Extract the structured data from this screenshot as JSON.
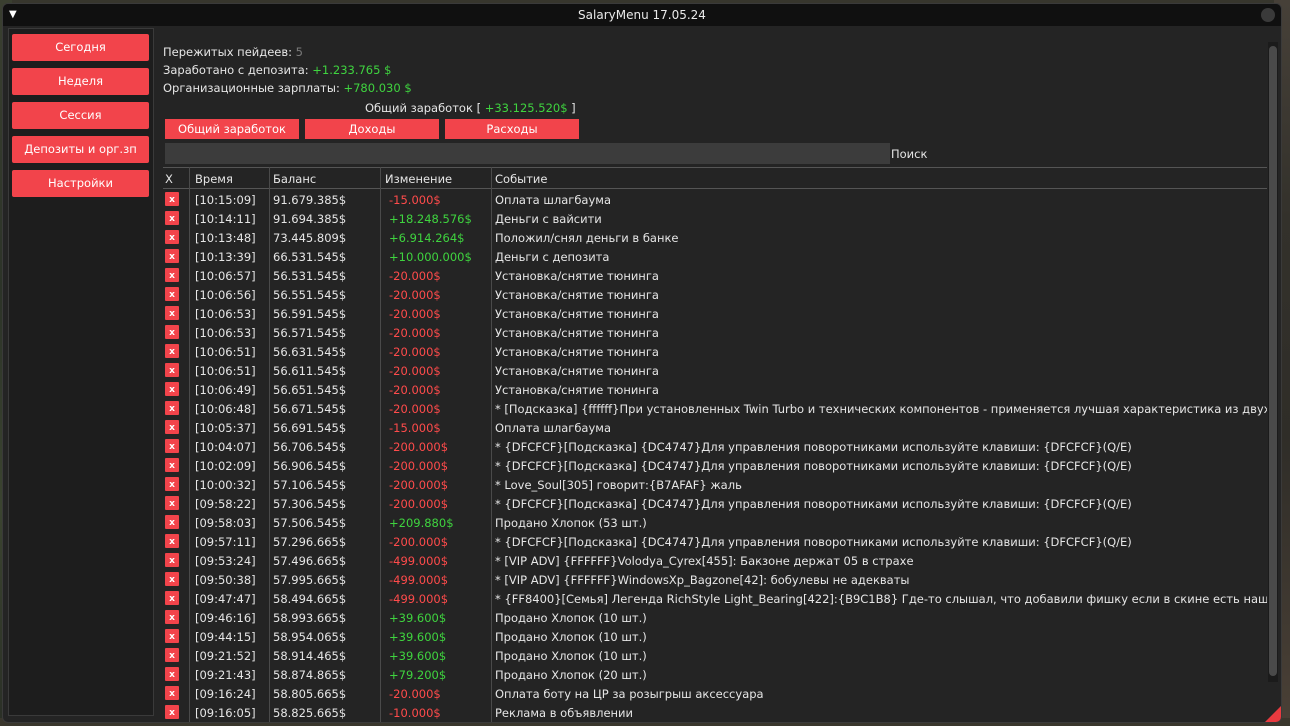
{
  "window": {
    "title": "SalaryMenu 17.05.24"
  },
  "sidebar": {
    "items": [
      {
        "label": "Сегодня"
      },
      {
        "label": "Неделя"
      },
      {
        "label": "Сессия"
      },
      {
        "label": "Депозиты и орг.зп"
      },
      {
        "label": "Настройки"
      }
    ]
  },
  "stats": {
    "paydays_label": "Пережитых пейдеев:",
    "paydays_value": "5",
    "deposit_label": "Заработано с депозита:",
    "deposit_value": "+1.233.765 $",
    "org_label": "Организационные зарплаты:",
    "org_value": "+780.030 $",
    "total_label": "Общий заработок",
    "total_open": "[",
    "total_value": "+33.125.520$",
    "total_close": "]"
  },
  "tabs": [
    {
      "label": "Общий заработок"
    },
    {
      "label": "Доходы"
    },
    {
      "label": "Расходы"
    }
  ],
  "search": {
    "label": "Поиск",
    "value": ""
  },
  "table": {
    "columns": [
      "X",
      "Время",
      "Баланс",
      "Изменение",
      "Событие"
    ],
    "delete_glyph": "x",
    "rows": [
      {
        "time": "[10:15:09]",
        "balance": "91.679.385$",
        "change": "-15.000$",
        "positive": false,
        "event": "Оплата шлагбаума"
      },
      {
        "time": "[10:14:11]",
        "balance": "91.694.385$",
        "change": "+18.248.576$",
        "positive": true,
        "event": "Деньги с вайсити"
      },
      {
        "time": "[10:13:48]",
        "balance": "73.445.809$",
        "change": "+6.914.264$",
        "positive": true,
        "event": "Положил/снял деньги в банке"
      },
      {
        "time": "[10:13:39]",
        "balance": "66.531.545$",
        "change": "+10.000.000$",
        "positive": true,
        "event": "Деньги с депозита"
      },
      {
        "time": "[10:06:57]",
        "balance": "56.531.545$",
        "change": "-20.000$",
        "positive": false,
        "event": "Установка/снятие тюнинга"
      },
      {
        "time": "[10:06:56]",
        "balance": "56.551.545$",
        "change": "-20.000$",
        "positive": false,
        "event": "Установка/снятие тюнинга"
      },
      {
        "time": "[10:06:53]",
        "balance": "56.591.545$",
        "change": "-20.000$",
        "positive": false,
        "event": "Установка/снятие тюнинга"
      },
      {
        "time": "[10:06:53]",
        "balance": "56.571.545$",
        "change": "-20.000$",
        "positive": false,
        "event": "Установка/снятие тюнинга"
      },
      {
        "time": "[10:06:51]",
        "balance": "56.631.545$",
        "change": "-20.000$",
        "positive": false,
        "event": "Установка/снятие тюнинга"
      },
      {
        "time": "[10:06:51]",
        "balance": "56.611.545$",
        "change": "-20.000$",
        "positive": false,
        "event": "Установка/снятие тюнинга"
      },
      {
        "time": "[10:06:49]",
        "balance": "56.651.545$",
        "change": "-20.000$",
        "positive": false,
        "event": "Установка/снятие тюнинга"
      },
      {
        "time": "[10:06:48]",
        "balance": "56.671.545$",
        "change": "-20.000$",
        "positive": false,
        "event": "* [Подсказка] {ffffff}При установленных Twin Turbo и технических компонентов - применяется лучшая характеристика из двух."
      },
      {
        "time": "[10:05:37]",
        "balance": "56.691.545$",
        "change": "-15.000$",
        "positive": false,
        "event": "Оплата шлагбаума"
      },
      {
        "time": "[10:04:07]",
        "balance": "56.706.545$",
        "change": "-200.000$",
        "positive": false,
        "event": "* {DFCFCF}[Подсказка] {DC4747}Для управления поворотниками используйте клавиши: {DFCFCF}(Q/E)"
      },
      {
        "time": "[10:02:09]",
        "balance": "56.906.545$",
        "change": "-200.000$",
        "positive": false,
        "event": "* {DFCFCF}[Подсказка] {DC4747}Для управления поворотниками используйте клавиши: {DFCFCF}(Q/E)"
      },
      {
        "time": "[10:00:32]",
        "balance": "57.106.545$",
        "change": "-200.000$",
        "positive": false,
        "event": "* Love_Soul[305] говорит:{B7AFAF} жаль"
      },
      {
        "time": "[09:58:22]",
        "balance": "57.306.545$",
        "change": "-200.000$",
        "positive": false,
        "event": "* {DFCFCF}[Подсказка] {DC4747}Для управления поворотниками используйте клавиши: {DFCFCF}(Q/E)"
      },
      {
        "time": "[09:58:03]",
        "balance": "57.506.545$",
        "change": "+209.880$",
        "positive": true,
        "event": "Продано Хлопок (53 шт.)"
      },
      {
        "time": "[09:57:11]",
        "balance": "57.296.665$",
        "change": "-200.000$",
        "positive": false,
        "event": "* {DFCFCF}[Подсказка] {DC4747}Для управления поворотниками используйте клавиши: {DFCFCF}(Q/E)"
      },
      {
        "time": "[09:53:24]",
        "balance": "57.496.665$",
        "change": "-499.000$",
        "positive": false,
        "event": "* [VIP ADV] {FFFFFF}Volodya_Cyrex[455]: Бакзоне держат 05 в страхе"
      },
      {
        "time": "[09:50:38]",
        "balance": "57.995.665$",
        "change": "-499.000$",
        "positive": false,
        "event": "* [VIP ADV] {FFFFFF}WindowsXp_Bagzone[42]: бобулевы не адекваты"
      },
      {
        "time": "[09:47:47]",
        "balance": "58.494.665$",
        "change": "-499.000$",
        "positive": false,
        "event": "* {FF8400}[Семья]  Легенда RichStyle Light_Bearing[422]:{B9C1B8} Где-то слышал, что добавили фишку если в скине есть нашива"
      },
      {
        "time": "[09:46:16]",
        "balance": "58.993.665$",
        "change": "+39.600$",
        "positive": true,
        "event": "Продано Хлопок (10 шт.)"
      },
      {
        "time": "[09:44:15]",
        "balance": "58.954.065$",
        "change": "+39.600$",
        "positive": true,
        "event": "Продано Хлопок (10 шт.)"
      },
      {
        "time": "[09:21:52]",
        "balance": "58.914.465$",
        "change": "+39.600$",
        "positive": true,
        "event": "Продано Хлопок (10 шт.)"
      },
      {
        "time": "[09:21:43]",
        "balance": "58.874.865$",
        "change": "+79.200$",
        "positive": true,
        "event": "Продано Хлопок (20 шт.)"
      },
      {
        "time": "[09:16:24]",
        "balance": "58.805.665$",
        "change": "-20.000$",
        "positive": false,
        "event": "Оплата боту на ЦР за розыгрыш аксессуара"
      },
      {
        "time": "[09:16:05]",
        "balance": "58.825.665$",
        "change": "-10.000$",
        "positive": false,
        "event": "Реклама в объявлении"
      }
    ]
  },
  "colors": {
    "accent": "#f2444b",
    "positive": "#3fd43f",
    "negative": "#ff4b4b"
  }
}
